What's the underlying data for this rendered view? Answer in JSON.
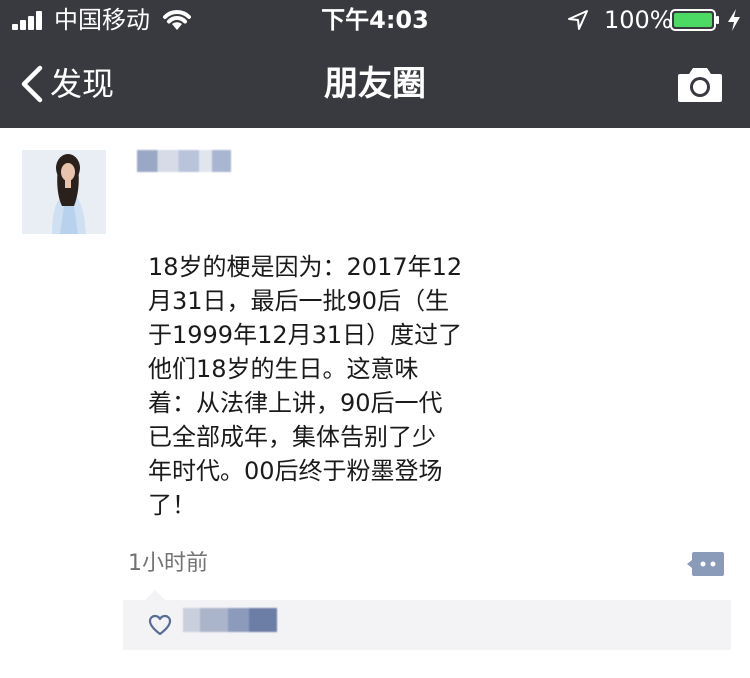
{
  "status_bar": {
    "carrier": "中国移动",
    "time": "下午4:03",
    "battery_percent": "100%",
    "battery_level": 1.0
  },
  "nav": {
    "back_label": "发现",
    "title": "朋友圈"
  },
  "post": {
    "text": "18岁的梗是因为：2017年12\n月31日，最后一批90后（生\n于1999年12月31日）度过了\n他们18岁的生日。这意味\n着：从法律上讲，90后一代\n已全部成年，集体告别了少\n年时代。00后终于粉墨登场\n了！",
    "timestamp": "1小时前"
  },
  "icons": {
    "back": "chevron-left-icon",
    "camera": "camera-icon",
    "more": "comment-more-icon",
    "like": "heart-icon"
  },
  "colors": {
    "header_bg": "#393a3f",
    "battery_green": "#4cd964",
    "like_blue": "#576b95"
  }
}
